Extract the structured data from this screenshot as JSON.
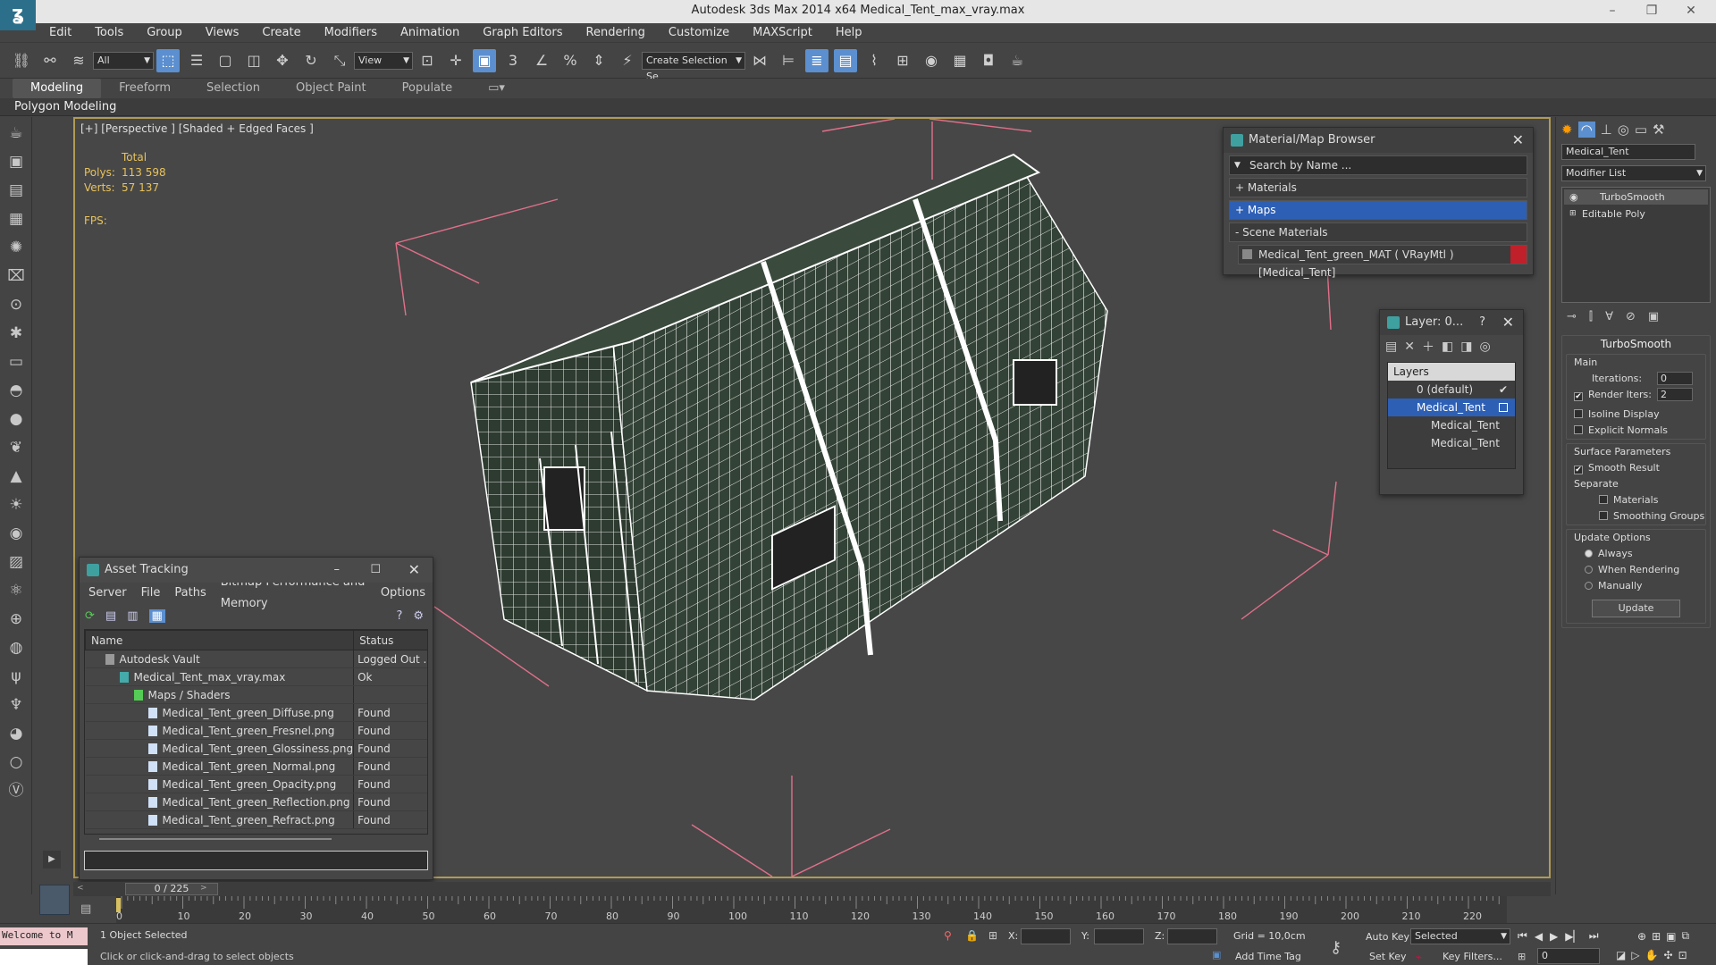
{
  "window": {
    "app_title": "Autodesk 3ds Max  2014 x64     Medical_Tent_max_vray.max",
    "minimize": "–",
    "restore": "❐",
    "close": "✕"
  },
  "menu": [
    "Edit",
    "Tools",
    "Group",
    "Views",
    "Create",
    "Modifiers",
    "Animation",
    "Graph Editors",
    "Rendering",
    "Customize",
    "MAXScript",
    "Help"
  ],
  "toolbar": {
    "filter_value": "All",
    "ref_coord_value": "View",
    "selection_set_placeholder": "Create Selection Se"
  },
  "ribbon": {
    "tabs": [
      "Modeling",
      "Freeform",
      "Selection",
      "Object Paint",
      "Populate"
    ],
    "active_tab": "Modeling",
    "sub_label": "Polygon Modeling"
  },
  "viewport": {
    "label": "[+] [Perspective ] [Shaded + Edged Faces ]",
    "stats": {
      "total_label": "Total",
      "polys_label": "Polys:",
      "polys_value": "113 598",
      "verts_label": "Verts:",
      "verts_value": "57 137",
      "fps_label": "FPS:"
    }
  },
  "material_browser": {
    "title": "Material/Map Browser",
    "search_placeholder": "Search by Name ...",
    "sections": [
      "+ Materials",
      "+ Maps",
      "- Scene Materials"
    ],
    "highlighted_section": "+ Maps",
    "scene_material": "Medical_Tent_green_MAT ( VRayMtl ) [Medical_Tent]"
  },
  "layer_panel": {
    "title": "Layer: 0...",
    "help": "?",
    "header": "Layers",
    "rows": [
      "0 (default)",
      "Medical_Tent",
      "Medical_Tent",
      "Medical_Tent"
    ]
  },
  "asset_tracking": {
    "title": "Asset Tracking",
    "menu": [
      "Server",
      "File",
      "Paths",
      "Bitmap Performance and Memory",
      "Options"
    ],
    "columns": [
      "Name",
      "Status"
    ],
    "rows": [
      {
        "name": "Autodesk Vault",
        "status": "Logged Out ..."
      },
      {
        "name": "Medical_Tent_max_vray.max",
        "status": "Ok"
      },
      {
        "name": "Maps / Shaders",
        "status": ""
      },
      {
        "name": "Medical_Tent_green_Diffuse.png",
        "status": "Found"
      },
      {
        "name": "Medical_Tent_green_Fresnel.png",
        "status": "Found"
      },
      {
        "name": "Medical_Tent_green_Glossiness.png",
        "status": "Found"
      },
      {
        "name": "Medical_Tent_green_Normal.png",
        "status": "Found"
      },
      {
        "name": "Medical_Tent_green_Opacity.png",
        "status": "Found"
      },
      {
        "name": "Medical_Tent_green_Reflection.png",
        "status": "Found"
      },
      {
        "name": "Medical_Tent_green_Refract.png",
        "status": "Found"
      }
    ]
  },
  "command_panel": {
    "object_name": "Medical_Tent",
    "modifier_list": "Modifier List",
    "stack": [
      "TurboSmooth",
      "Editable Poly"
    ],
    "rollout_title": "TurboSmooth",
    "main_label": "Main",
    "iterations_label": "Iterations:",
    "iterations_value": "0",
    "render_iters_label": "Render Iters:",
    "render_iters_value": "2",
    "isoline": "Isoline Display",
    "explicit_normals": "Explicit Normals",
    "surface_params": "Surface Parameters",
    "smooth_result": "Smooth Result",
    "separate": "Separate",
    "materials": "Materials",
    "smoothing_groups": "Smoothing Groups",
    "update_options": "Update Options",
    "always": "Always",
    "when_rendering": "When Rendering",
    "manually": "Manually",
    "update_button": "Update"
  },
  "timeline": {
    "frame_counter": "0 / 225",
    "ticks": [
      "0",
      "10",
      "20",
      "30",
      "40",
      "50",
      "60",
      "70",
      "80",
      "90",
      "100",
      "110",
      "120",
      "130",
      "140",
      "150",
      "160",
      "170",
      "180",
      "190",
      "200",
      "210",
      "220"
    ]
  },
  "status": {
    "welcome": "Welcome to M",
    "selection_info": "1 Object Selected",
    "prompt": "Click or click-and-drag to select objects",
    "x_label": "X:",
    "y_label": "Y:",
    "z_label": "Z:",
    "grid": "Grid = 10,0cm",
    "add_time_tag": "Add Time Tag",
    "auto_key": "Auto Key",
    "set_key": "Set Key",
    "selected_value": "Selected",
    "key_filters": "Key Filters...",
    "frame_field": "0"
  },
  "colors": {
    "accent": "#5b8fcf",
    "highlight": "#2d5fb5",
    "viewport_border": "#b09a55",
    "stats": "#e8c25c"
  }
}
